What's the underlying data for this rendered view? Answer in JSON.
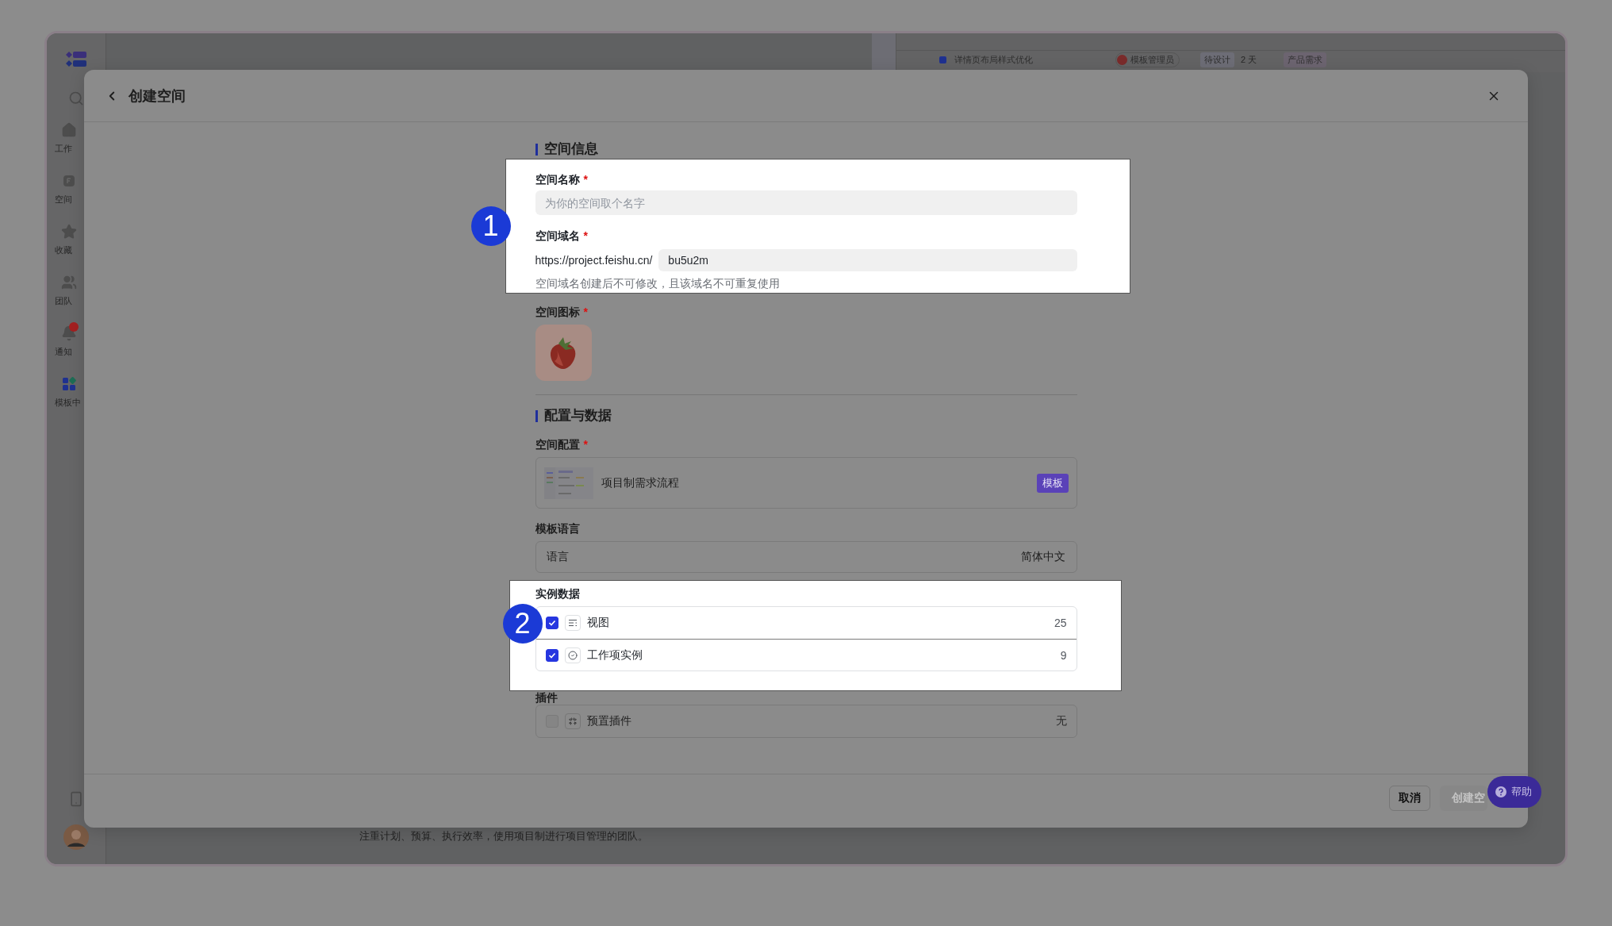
{
  "app": {
    "sidebar": {
      "items": [
        {
          "label": "工作",
          "selected": false,
          "badge": false
        },
        {
          "label": "空间",
          "selected": false,
          "badge": false
        },
        {
          "label": "收藏",
          "selected": false,
          "badge": false
        },
        {
          "label": "团队",
          "selected": false,
          "badge": false
        },
        {
          "label": "通知",
          "selected": false,
          "badge": true
        },
        {
          "label": "模板中",
          "selected": true,
          "badge": false
        }
      ]
    },
    "background_row": {
      "title": "详情页布局样式优化",
      "owner": "模板管理员",
      "status": "待设计",
      "duration": "2 天",
      "type": "产品需求"
    },
    "background_text": "注重计划、预算、执行效率，使用项目制进行项目管理的团队。"
  },
  "dialog": {
    "title": "创建空间",
    "space_info": {
      "title": "空间信息",
      "callout": "1",
      "name_field": {
        "label": "空间名称",
        "required_mark": "*",
        "placeholder": "为你的空间取个名字"
      },
      "domain_field": {
        "label": "空间域名",
        "required_mark": "*",
        "prefix": "https://project.feishu.cn/",
        "value": "bu5u2m",
        "hint": "空间域名创建后不可修改，且该域名不可重复使用"
      },
      "icon_field": {
        "label": "空间图标",
        "required_mark": "*"
      }
    },
    "config": {
      "title": "配置与数据",
      "space_config": {
        "label": "空间配置",
        "required_mark": "*",
        "template_name": "项目制需求流程",
        "tag": "模板"
      },
      "template_language": {
        "label": "模板语言",
        "name": "语言",
        "value": "简体中文"
      },
      "sample_data": {
        "label": "实例数据",
        "callout": "2",
        "items": [
          {
            "label": "视图",
            "count": "25",
            "checked": true
          },
          {
            "label": "工作项实例",
            "count": "9",
            "checked": true
          }
        ]
      },
      "plugins": {
        "label": "插件",
        "items": [
          {
            "label": "预置插件",
            "count": "无",
            "checked": false,
            "disabled": true
          }
        ]
      }
    },
    "footer": {
      "buttons": [
        {
          "label": "取消",
          "kind": "secondary",
          "disabled": false
        },
        {
          "label": "创建空",
          "kind": "primary",
          "disabled": true
        }
      ]
    }
  },
  "help_button": {
    "label": "帮助"
  }
}
